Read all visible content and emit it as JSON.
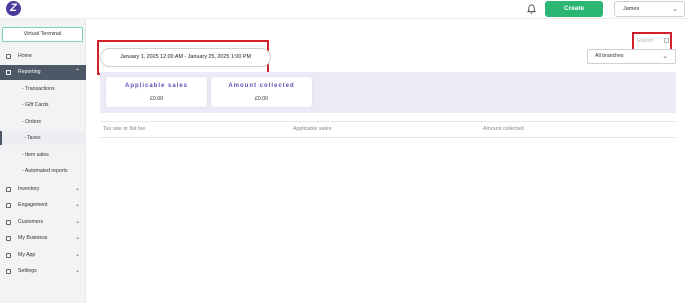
{
  "topbar": {
    "logo_letter": "Z",
    "create_label": "Create",
    "user_name": "James"
  },
  "sidebar": {
    "virtual_terminal": "Virtual Terminal",
    "home": "Home",
    "reporting": "Reporting",
    "reporting_sub": [
      "- Transactions",
      "- Gift Cards",
      "- Orders",
      "- Taxes",
      "- Item sales",
      "- Automated reports"
    ],
    "inventory": "Inventory",
    "engagement": "Engagement",
    "customers": "Customers",
    "my_business": "My Business",
    "my_app": "My App",
    "settings": "Settings"
  },
  "main": {
    "date_range": "January 1, 2025 12:00 AM - January 25, 2025 1:00 PM",
    "export_label": "Export",
    "branch_select": "All branches",
    "cards": [
      {
        "title": "Applicable sales",
        "value": "£0.00"
      },
      {
        "title": "Amount collected",
        "value": "£0.00"
      }
    ],
    "table_headers": [
      "Tax rate or flat fee",
      "Applicable sales",
      "Amount collected"
    ]
  },
  "colors": {
    "accent": "#2bb673",
    "nav_active": "#4d5866",
    "highlight": "#d0202a",
    "band": "#eceaf7",
    "card_title": "#5a4fb5"
  }
}
